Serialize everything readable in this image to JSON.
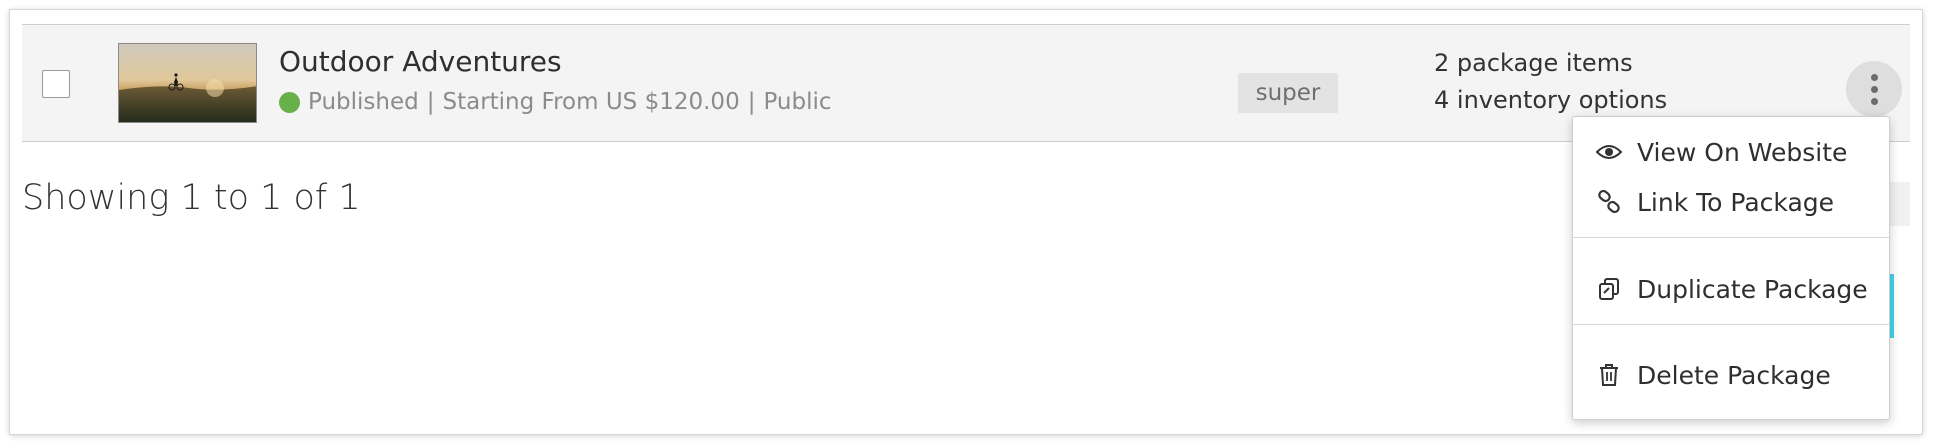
{
  "package": {
    "title": "Outdoor Adventures",
    "status": "Published",
    "status_color": "#67b04a",
    "separator": "|",
    "price_text": "Starting From US $120.00",
    "visibility": "Public",
    "tag": "super",
    "items_count": "2 package items",
    "inventory_count": "4 inventory options",
    "thumbnail_icon": "landscape-photo"
  },
  "pagination": {
    "showing_text": "Showing 1 to 1 of 1"
  },
  "menu": {
    "items": [
      {
        "label": "View On Website",
        "icon": "eye-icon"
      },
      {
        "label": "Link To Package",
        "icon": "link-icon"
      },
      {
        "label": "Duplicate Package",
        "icon": "copy-icon"
      },
      {
        "label": "Delete Package",
        "icon": "trash-icon"
      }
    ],
    "highlight_color": "#40d5ec"
  }
}
